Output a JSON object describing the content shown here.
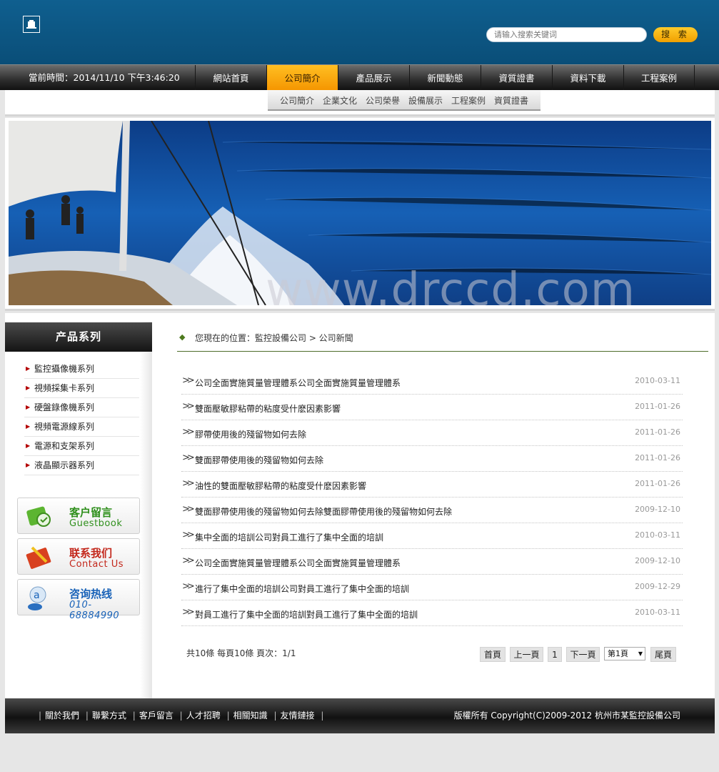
{
  "search": {
    "placeholder": "请输入搜索关键词",
    "button_label": "搜 索"
  },
  "nav": {
    "clock_prefix": "當前時間：",
    "clock": "2014/11/10 下午3:46:20",
    "items": [
      {
        "label": "網站首頁"
      },
      {
        "label": "公司簡介"
      },
      {
        "label": "產品展示"
      },
      {
        "label": "新聞動態"
      },
      {
        "label": "資質證書"
      },
      {
        "label": "資料下載"
      },
      {
        "label": "工程案例"
      }
    ],
    "active_index": 1
  },
  "subnav": [
    "公司簡介",
    "企業文化",
    "公司榮譽",
    "設備展示",
    "工程案例",
    "資質證書"
  ],
  "banner": {
    "watermark": "www.drccd.com"
  },
  "sidebar": {
    "title": "产品系列",
    "items": [
      "監控攝像機系列",
      "視頻採集卡系列",
      "硬盤錄像機系列",
      "視頻電源線系列",
      "電源和支架系列",
      "液晶顯示器系列"
    ],
    "promos": [
      {
        "cn": "客户留言",
        "en": "Guestbook",
        "color": "#2f8f1c"
      },
      {
        "cn": "联系我们",
        "en": "Contact Us",
        "color": "#c3271b"
      },
      {
        "cn": "咨询热线",
        "en": "010-68884990",
        "color": "#1862b8"
      }
    ]
  },
  "breadcrumb": "您現在的位置：監控設備公司 > 公司新聞",
  "news": [
    {
      "title": "公司全面實施質量管理體系公司全面實施質量管理體系",
      "date": "2010-03-11"
    },
    {
      "title": "雙面壓敏膠粘帶的粘度受什麽因素影響",
      "date": "2011-01-26"
    },
    {
      "title": "膠帶使用後的殘留物如何去除",
      "date": "2011-01-26"
    },
    {
      "title": "雙面膠帶使用後的殘留物如何去除",
      "date": "2011-01-26"
    },
    {
      "title": "油性的雙面壓敏膠粘帶的粘度受什麽因素影響",
      "date": "2011-01-26"
    },
    {
      "title": "雙面膠帶使用後的殘留物如何去除雙面膠帶使用後的殘留物如何去除",
      "date": "2009-12-10"
    },
    {
      "title": "集中全面的培訓公司對員工進行了集中全面的培訓",
      "date": "2010-03-11"
    },
    {
      "title": "公司全面實施質量管理體系公司全面實施質量管理體系",
      "date": "2009-12-10"
    },
    {
      "title": "進行了集中全面的培訓公司對員工進行了集中全面的培訓",
      "date": "2009-12-29"
    },
    {
      "title": "對員工進行了集中全面的培訓對員工進行了集中全面的培訓",
      "date": "2010-03-11"
    }
  ],
  "pagination": {
    "info": "共10條 每頁10條 頁次：1/1",
    "first": "首頁",
    "prev": "上一頁",
    "current": "1",
    "next": "下一頁",
    "select": "第1頁",
    "last": "尾頁"
  },
  "footer": {
    "links": [
      "關於我們",
      "聯繫方式",
      "客戶留言",
      "人才招聘",
      "相關知識",
      "友情鏈接"
    ],
    "copyright": "版權所有 Copyright(C)2009-2012 杭州市某監控設備公司"
  }
}
